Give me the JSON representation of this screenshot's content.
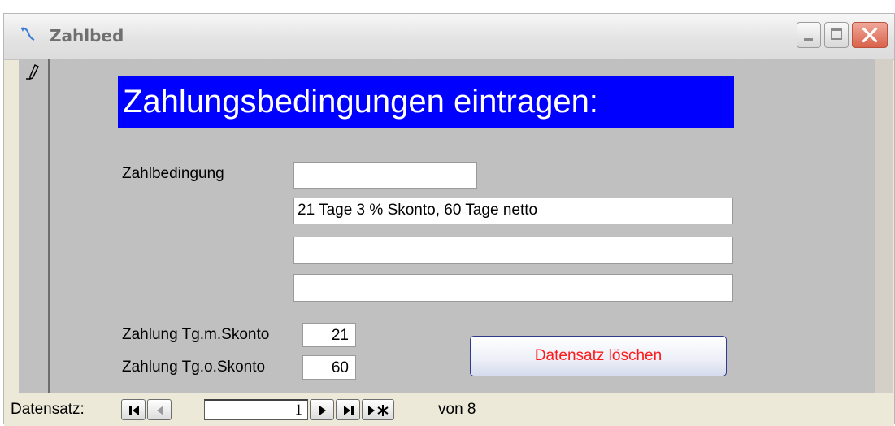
{
  "window": {
    "title": "Zahlbed",
    "icons": {
      "app": "form-icon",
      "minimize": "minimize-icon",
      "maximize": "maximize-icon",
      "close": "close-icon"
    }
  },
  "form": {
    "heading": "Zahlungsbedingungen eintragen:",
    "zahlbedingung_label": "Zahlbedingung",
    "zahlbedingung_code": "",
    "zahlbedingung_text1": "21 Tage 3 % Skonto, 60 Tage netto",
    "zahlbedingung_text2": "",
    "zahlbedingung_text3": "",
    "tage_mit_skonto_label": "Zahlung Tg.m.Skonto",
    "tage_mit_skonto_value": "21",
    "tage_ohne_skonto_label": "Zahlung Tg.o.Skonto",
    "tage_ohne_skonto_value": "60",
    "delete_button": "Datensatz löschen",
    "delete_color": "#ff1a1a",
    "heading_bg": "#0000ff"
  },
  "navigation": {
    "label": "Datensatz:",
    "current_record": "1",
    "total_text": "von  8",
    "icons": [
      "first-record-icon",
      "previous-record-icon",
      "next-record-icon",
      "last-record-icon",
      "new-record-icon"
    ]
  }
}
